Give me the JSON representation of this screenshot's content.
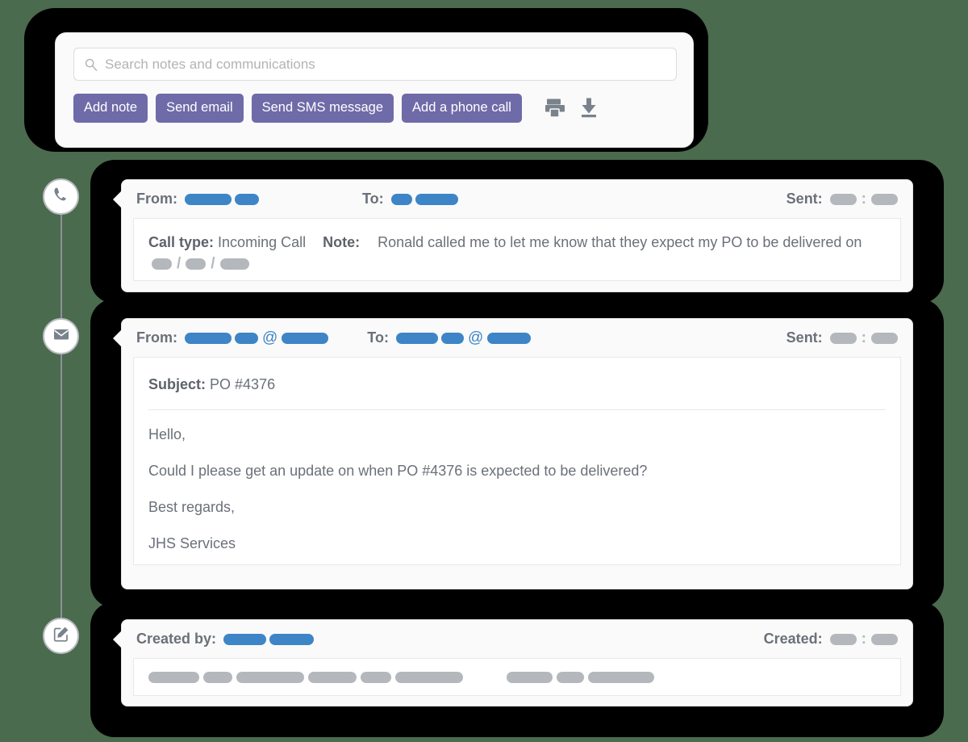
{
  "search": {
    "placeholder": "Search notes and communications",
    "value": "",
    "icon": "search-icon"
  },
  "toolbar": {
    "buttons": [
      {
        "label": "Add note",
        "name": "add-note-button"
      },
      {
        "label": "Send email",
        "name": "send-email-button"
      },
      {
        "label": "Send SMS message",
        "name": "send-sms-button"
      },
      {
        "label": "Add a phone call",
        "name": "add-phone-call-button"
      }
    ],
    "icons": [
      {
        "name": "print-icon",
        "title": "Print"
      },
      {
        "name": "download-icon",
        "title": "Download"
      }
    ],
    "accent_color": "#6f6ba8"
  },
  "colors": {
    "background": "#4a6b4d",
    "shadow": "#000000",
    "redaction_blue": "#3d85c6",
    "redaction_gray": "#b4b8bd",
    "text": "#6b7079",
    "panel": "#fafafa"
  },
  "timeline": {
    "nodes": [
      {
        "name": "timeline-node-phone-call",
        "icon": "phone-icon"
      },
      {
        "name": "timeline-node-email",
        "icon": "envelope-icon"
      },
      {
        "name": "timeline-node-note",
        "icon": "edit-note-icon"
      }
    ]
  },
  "events": [
    {
      "type": "phone-call",
      "header": {
        "from_label": "From:",
        "from_value_redacted": true,
        "to_label": "To:",
        "to_value_redacted": true,
        "sent_label": "Sent:",
        "sent_value_redacted": true
      },
      "body": {
        "call_type_label": "Call type:",
        "call_type_value": "Incoming Call",
        "note_label": "Note:",
        "note_value": "Ronald called me to let me know that they expect my PO to be",
        "note_value_line2": "delivered on",
        "note_date_redacted": true
      }
    },
    {
      "type": "email",
      "header": {
        "from_label": "From:",
        "from_value_redacted": true,
        "to_label": "To:",
        "to_value_redacted": true,
        "sent_label": "Sent:",
        "sent_value_redacted": true
      },
      "body": {
        "subject_label": "Subject:",
        "subject_value": "PO #4376",
        "paragraphs": [
          "Hello,",
          "Could I please get an update on when PO #4376 is expected to be delivered?",
          "Best regards,",
          "JHS Services"
        ]
      }
    },
    {
      "type": "note",
      "header": {
        "created_by_label": "Created by:",
        "created_by_redacted": true,
        "created_label": "Created:",
        "created_value_redacted": true
      },
      "body": {
        "content_redacted": true
      }
    }
  ]
}
